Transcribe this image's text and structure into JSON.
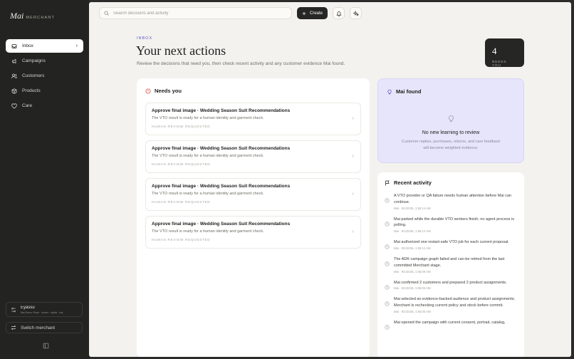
{
  "sidebar": {
    "brand_logo": "Mai",
    "brand_sub": "MERCHANT",
    "items": [
      {
        "label": "Inbox",
        "icon": "inbox-icon",
        "active": true
      },
      {
        "label": "Campaigns",
        "icon": "megaphone-icon"
      },
      {
        "label": "Customers",
        "icon": "users-icon"
      },
      {
        "label": "Products",
        "icon": "box-icon"
      },
      {
        "label": "Care",
        "icon": "heart-icon"
      }
    ],
    "user": {
      "name": "Eyassu",
      "sub": "Mai Demo Store · owner · stylist · ma..."
    },
    "switch_label": "Switch merchant"
  },
  "topbar": {
    "search_placeholder": "Search decisions and activity",
    "create_label": "Create"
  },
  "header": {
    "eyebrow": "INBOX",
    "title": "Your next actions",
    "subtitle": "Review the decisions that need you, then check recent activity and any customer evidence Mai found.",
    "count": "4",
    "count_label": "NEEDS YOU"
  },
  "needs_you": {
    "title": "Needs you",
    "tasks": [
      {
        "title": "Approve final image · Wedding Season Suit Recommendations",
        "desc": "The VTO result is ready for a human identity and garment check.",
        "tag": "HUMAN REVIEW REQUESTED"
      },
      {
        "title": "Approve final image · Wedding Season Suit Recommendations",
        "desc": "The VTO result is ready for a human identity and garment check.",
        "tag": "HUMAN REVIEW REQUESTED"
      },
      {
        "title": "Approve final image · Wedding Season Suit Recommendations",
        "desc": "The VTO result is ready for a human identity and garment check.",
        "tag": "HUMAN REVIEW REQUESTED"
      },
      {
        "title": "Approve final image · Wedding Season Suit Recommendations",
        "desc": "The VTO result is ready for a human identity and garment check.",
        "tag": "HUMAN REVIEW REQUESTED"
      }
    ]
  },
  "mai_found": {
    "title": "Mai found",
    "empty_title": "No new learning to review",
    "empty_desc": "Customer replies, purchases, returns, and care feedback will become weighted evidence."
  },
  "recent_activity": {
    "title": "Recent activity",
    "items": [
      {
        "text": "A VTO provider or QA failure needs human attention before Mai can continue.",
        "time": "Mai · 9/1/2026, 1:56:14 AM"
      },
      {
        "text": "Mai parked while the durable VTO workers finish; no agent process is polling.",
        "time": "Mai · 9/1/2026, 1:55:12 AM"
      },
      {
        "text": "Mai authorized one restart-safe VTO job for each current proposal.",
        "time": "Mai · 9/1/2026, 1:55:12 AM"
      },
      {
        "text": "The ADK campaign graph failed and can be retried from the last committed Merchant stage.",
        "time": "Mai · 9/1/2026, 1:55:09 AM"
      },
      {
        "text": "Mai confirmed 2 customers and prepared 2 product assignments.",
        "time": "Mai · 9/1/2026, 1:55:05 AM"
      },
      {
        "text": "Mai selected an evidence-backed audience and product assignments; Merchant is rechecking current policy and stock before commit.",
        "time": "Mai · 9/1/2026, 1:55:05 AM"
      },
      {
        "text": "Mai opened the campaign with current consent, portrait, catalog,",
        "time": ""
      }
    ]
  }
}
